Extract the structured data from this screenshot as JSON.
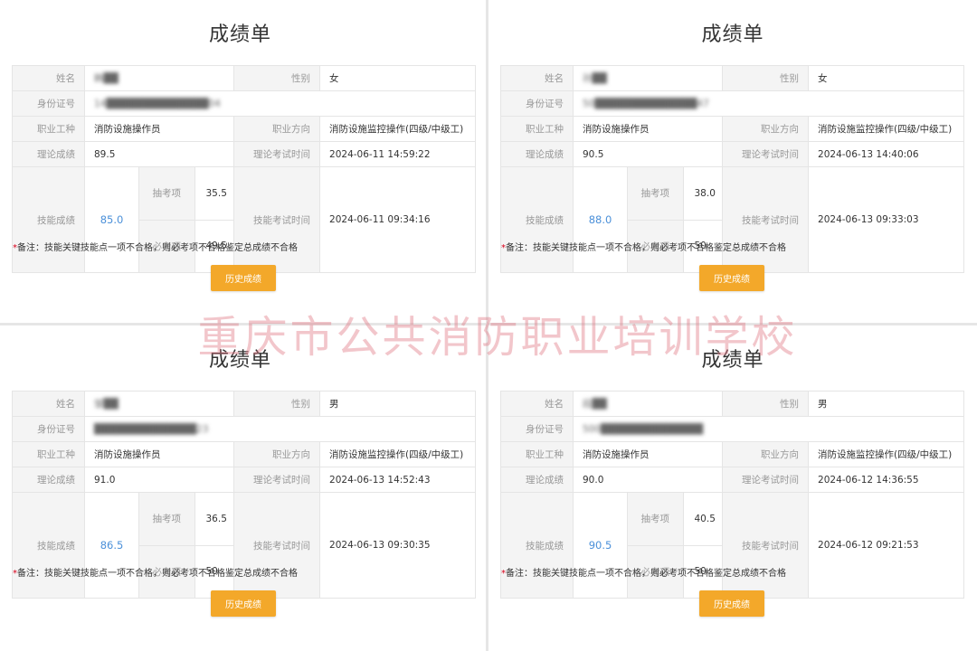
{
  "watermark": "重庆市公共消防职业培训学校",
  "labels": {
    "name": "姓名",
    "gender": "性别",
    "id": "身份证号",
    "occupation": "职业工种",
    "direction": "职业方向",
    "theory_score": "理论成绩",
    "theory_time": "理论考试时间",
    "skill_score": "技能成绩",
    "random_item": "抽考项",
    "required_item": "必考项",
    "skill_time": "技能考试时间"
  },
  "cards": [
    {
      "title": "成绩单",
      "name": "韩██",
      "gender": "女",
      "id_number": "14██████████████04",
      "occupation": "消防设施操作员",
      "direction": "消防设施监控操作(四级/中级工)",
      "theory_score": "89.5",
      "theory_time": "2024-06-11 14:59:22",
      "skill_score": "85.0",
      "random_score": "35.5",
      "required_score": "49.5",
      "skill_time": "2024-06-11 09:34:16",
      "note_star": "*",
      "note": "备注：技能关键技能点一项不合格，则必考项不合格鉴定总成绩不合格",
      "history_button": "历史成绩"
    },
    {
      "title": "成绩单",
      "name": "孙██",
      "gender": "女",
      "id_number": "50██████████████47",
      "occupation": "消防设施操作员",
      "direction": "消防设施监控操作(四级/中级工)",
      "theory_score": "90.5",
      "theory_time": "2024-06-13 14:40:06",
      "skill_score": "88.0",
      "random_score": "38.0",
      "required_score": "50",
      "skill_time": "2024-06-13 09:33:03",
      "note_star": "*",
      "note": "备注：技能关键技能点一项不合格，则必考项不合格鉴定总成绩不合格",
      "history_button": "历史成绩"
    },
    {
      "title": "成绩单",
      "name": "邹██",
      "gender": "男",
      "id_number": "██████████████23",
      "occupation": "消防设施操作员",
      "direction": "消防设施监控操作(四级/中级工)",
      "theory_score": "91.0",
      "theory_time": "2024-06-13 14:52:43",
      "skill_score": "86.5",
      "random_score": "36.5",
      "required_score": "50",
      "skill_time": "2024-06-13 09:30:35",
      "note_star": "*",
      "note": "备注：技能关键技能点一项不合格，则必考项不合格鉴定总成绩不合格",
      "history_button": "历史成绩"
    },
    {
      "title": "成绩单",
      "name": "段██",
      "gender": "男",
      "id_number": "500██████████████",
      "occupation": "消防设施操作员",
      "direction": "消防设施监控操作(四级/中级工)",
      "theory_score": "90.0",
      "theory_time": "2024-06-12 14:36:55",
      "skill_score": "90.5",
      "random_score": "40.5",
      "required_score": "50",
      "skill_time": "2024-06-12 09:21:53",
      "note_star": "*",
      "note": "备注：技能关键技能点一项不合格，则必考项不合格鉴定总成绩不合格",
      "history_button": "历史成绩"
    }
  ]
}
